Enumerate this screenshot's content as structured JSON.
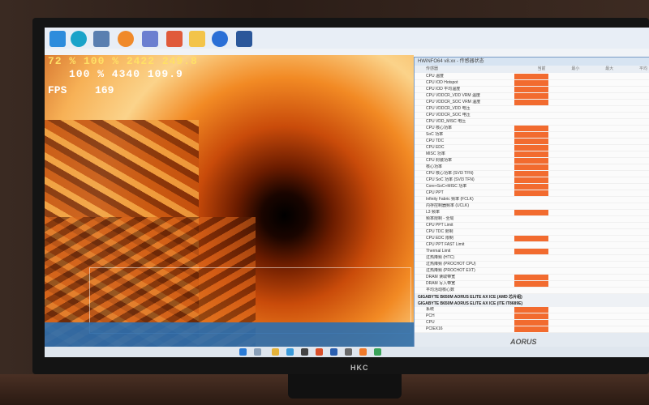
{
  "osd": {
    "line1": "72 %   100 %   2422   249.8",
    "line2": "100 %   4340   109.9",
    "fps_label": "FPS",
    "fps_value": "169"
  },
  "hwinfo": {
    "title": "HWiNFO64 v8.xx - 传感器状态",
    "columns": [
      "传感器",
      "当前",
      "最小",
      "最大",
      "平均"
    ],
    "rows": [
      {
        "name": "CPU 温度",
        "cur": "",
        "min": "",
        "max": "",
        "avg": "",
        "highlight": true
      },
      {
        "name": "CPU IOD Hotspot",
        "cur": "",
        "min": "",
        "max": "",
        "avg": "",
        "highlight": true
      },
      {
        "name": "CPU IOD 平均温度",
        "cur": "",
        "min": "",
        "max": "",
        "avg": "",
        "highlight": true
      },
      {
        "name": "CPU VDDCR_VDD VRM 温度",
        "cur": "",
        "min": "",
        "max": "",
        "avg": "",
        "highlight": true
      },
      {
        "name": "CPU VDDCR_SOC VRM 温度",
        "cur": "",
        "min": "",
        "max": "",
        "avg": "",
        "highlight": true
      },
      {
        "name": "CPU VDDCR_VDD 电压",
        "cur": "",
        "min": "",
        "max": "",
        "avg": "",
        "highlight": false
      },
      {
        "name": "CPU VDDCR_SOC 电压",
        "cur": "",
        "min": "",
        "max": "",
        "avg": "",
        "highlight": false
      },
      {
        "name": "CPU VDD_MISC 电压",
        "cur": "",
        "min": "",
        "max": "",
        "avg": "",
        "highlight": false
      },
      {
        "name": "CPU 核心功率",
        "cur": "",
        "min": "",
        "max": "",
        "avg": "",
        "highlight": true
      },
      {
        "name": "SoC 功率",
        "cur": "",
        "min": "",
        "max": "",
        "avg": "",
        "highlight": true
      },
      {
        "name": "CPU TDC",
        "cur": "",
        "min": "",
        "max": "",
        "avg": "",
        "highlight": true
      },
      {
        "name": "CPU EDC",
        "cur": "",
        "min": "",
        "max": "",
        "avg": "",
        "highlight": true
      },
      {
        "name": "MISC 功率",
        "cur": "",
        "min": "",
        "max": "",
        "avg": "",
        "highlight": true
      },
      {
        "name": "CPU 封装功率",
        "cur": "",
        "min": "",
        "max": "",
        "avg": "",
        "highlight": true
      },
      {
        "name": "核心功率",
        "cur": "",
        "min": "",
        "max": "",
        "avg": "",
        "highlight": true
      },
      {
        "name": "CPU 核心功率 (SVI3 TFN)",
        "cur": "",
        "min": "",
        "max": "",
        "avg": "",
        "highlight": true
      },
      {
        "name": "CPU SoC 功率 (SVI3 TFN)",
        "cur": "",
        "min": "",
        "max": "",
        "avg": "",
        "highlight": true
      },
      {
        "name": "Core+SoC+MISC 功率",
        "cur": "",
        "min": "",
        "max": "",
        "avg": "",
        "highlight": true
      },
      {
        "name": "CPU PPT",
        "cur": "",
        "min": "",
        "max": "",
        "avg": "",
        "highlight": true
      },
      {
        "name": "Infinity Fabric 频率 (FCLK)",
        "cur": "",
        "min": "",
        "max": "",
        "avg": "",
        "highlight": false
      },
      {
        "name": "内存控制器频率 (UCLK)",
        "cur": "",
        "min": "",
        "max": "",
        "avg": "",
        "highlight": false
      },
      {
        "name": "L3 频率",
        "cur": "",
        "min": "",
        "max": "",
        "avg": "",
        "highlight": true
      },
      {
        "name": "频率限制 - 全局",
        "cur": "",
        "min": "",
        "max": "",
        "avg": "",
        "highlight": false
      },
      {
        "name": "CPU PPT Limit",
        "cur": "",
        "min": "",
        "max": "",
        "avg": "",
        "highlight": false
      },
      {
        "name": "CPU TDC 限制",
        "cur": "",
        "min": "",
        "max": "",
        "avg": "",
        "highlight": false
      },
      {
        "name": "CPU EDC 限制",
        "cur": "",
        "min": "",
        "max": "",
        "avg": "",
        "highlight": true
      },
      {
        "name": "CPU PPT FAST Limit",
        "cur": "",
        "min": "",
        "max": "",
        "avg": "",
        "highlight": false
      },
      {
        "name": "Thermal Limit",
        "cur": "",
        "min": "",
        "max": "",
        "avg": "",
        "highlight": true
      },
      {
        "name": "过热降频 (HTC)",
        "cur": "",
        "min": "",
        "max": "",
        "avg": "",
        "highlight": false
      },
      {
        "name": "过热降频 (PROCHOT CPU)",
        "cur": "",
        "min": "",
        "max": "",
        "avg": "",
        "highlight": false
      },
      {
        "name": "过热降频 (PROCHOT EXT)",
        "cur": "",
        "min": "",
        "max": "",
        "avg": "",
        "highlight": false
      },
      {
        "name": "DRAM 读取带宽",
        "cur": "",
        "min": "",
        "max": "",
        "avg": "",
        "highlight": true
      },
      {
        "name": "DRAM 写入带宽",
        "cur": "",
        "min": "",
        "max": "",
        "avg": "",
        "highlight": true
      },
      {
        "name": "平均活动核心数",
        "cur": "",
        "min": "",
        "max": "",
        "avg": "",
        "highlight": false
      }
    ],
    "section1": "GIGABYTE B650M AORUS ELITE AX ICE (AMD 芯片组)",
    "section2": "GIGABYTE B650M AORUS ELITE AX ICE (ITE IT8689E)",
    "rows2": [
      {
        "name": "系统",
        "cur": "",
        "min": "",
        "max": "",
        "avg": "",
        "highlight": true
      },
      {
        "name": "PCH",
        "cur": "",
        "min": "",
        "max": "",
        "avg": "",
        "highlight": true
      },
      {
        "name": "CPU",
        "cur": "",
        "min": "",
        "max": "",
        "avg": "",
        "highlight": true
      },
      {
        "name": "PCIEX16",
        "cur": "",
        "min": "",
        "max": "",
        "avg": "",
        "highlight": true
      }
    ],
    "footer_logo": "AORUS"
  },
  "monitor": {
    "brand": "HKC"
  },
  "taskbar": {
    "clock": ""
  }
}
